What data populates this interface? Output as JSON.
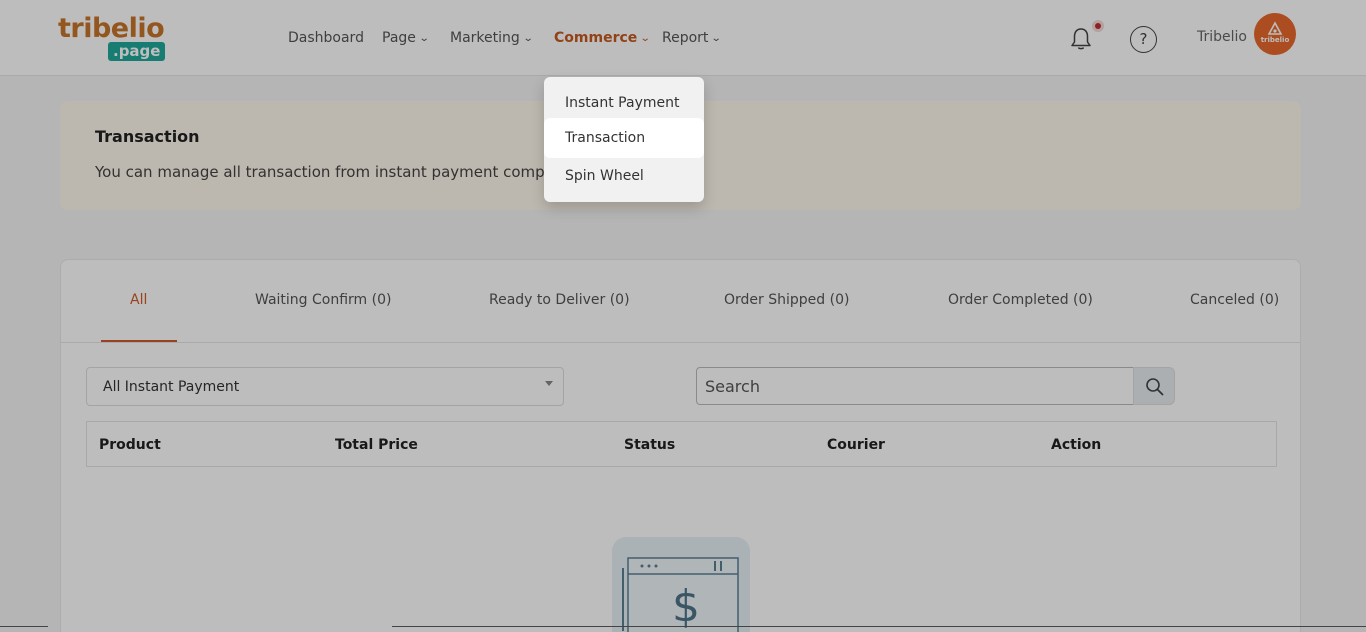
{
  "logo": {
    "top": "tribelio",
    "sub": ".page"
  },
  "nav": {
    "dashboard": "Dashboard",
    "page": "Page",
    "marketing": "Marketing",
    "commerce": "Commerce",
    "report": "Report",
    "chevron": "⌄"
  },
  "user": {
    "name": "Tribelio",
    "avatar_text": "tribelio"
  },
  "help_symbol": "?",
  "info": {
    "title": "Transaction",
    "description": "You can manage all transaction from instant payment componen"
  },
  "tabs": [
    {
      "label": "All"
    },
    {
      "label": "Waiting Confirm (0)"
    },
    {
      "label": "Ready to Deliver (0)"
    },
    {
      "label": "Order Shipped (0)"
    },
    {
      "label": "Order Completed (0)"
    },
    {
      "label": "Canceled (0)"
    }
  ],
  "filter": {
    "selected": "All Instant Payment"
  },
  "search": {
    "placeholder": "Search"
  },
  "table": {
    "headers": [
      "Product",
      "Total Price",
      "Status",
      "Courier",
      "Action"
    ]
  },
  "dropdown": {
    "items": [
      "Instant Payment",
      "Transaction",
      "Spin Wheel"
    ]
  },
  "empty_symbol": "$",
  "colors": {
    "accent": "#c65a1e",
    "logo_orange": "#c8752a",
    "logo_teal": "#1fa89a",
    "avatar": "#e8682d",
    "notification": "#c42a2a"
  }
}
